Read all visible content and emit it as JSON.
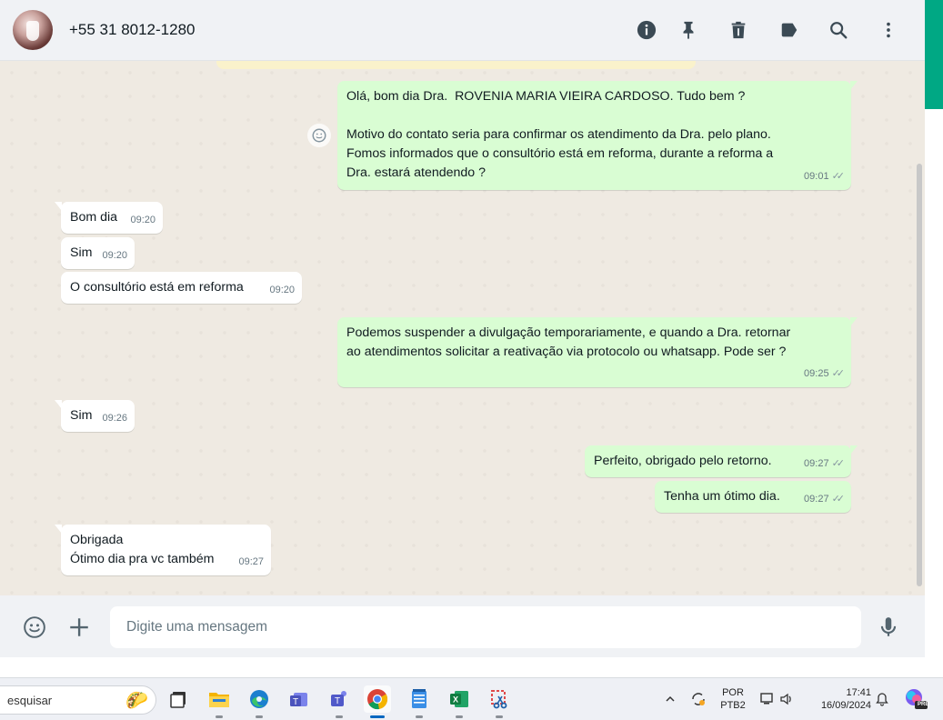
{
  "header": {
    "contact_name": "+55 31 8012-1280",
    "icons": [
      "info-icon",
      "pin-icon",
      "delete-icon",
      "label-icon",
      "search-icon",
      "menu-icon"
    ]
  },
  "messages": [
    {
      "direction": "out",
      "text": "Olá, bom dia Dra.  ROVENIA MARIA VIEIRA CARDOSO. Tudo bem ?\n\nMotivo do contato seria para confirmar os atendimento da Dra. pelo plano.\nFomos informados que o consultório está em reforma, durante a reforma a\nDra. estará atendendo ?",
      "time": "09:01",
      "ticks": "✓✓"
    },
    {
      "direction": "in",
      "text": "Bom dia",
      "time": "09:20"
    },
    {
      "direction": "in",
      "text": "Sim",
      "time": "09:20"
    },
    {
      "direction": "in",
      "text": "O consultório está em reforma",
      "time": "09:20"
    },
    {
      "direction": "out",
      "text": "Podemos suspender a divulgação temporariamente, e quando a Dra. retornar\nao atendimentos solicitar a reativação via protocolo ou whatsapp. Pode ser ?",
      "time": "09:25",
      "ticks": "✓✓"
    },
    {
      "direction": "in",
      "text": "Sim",
      "time": "09:26"
    },
    {
      "direction": "out",
      "text": "Perfeito, obrigado pelo retorno.",
      "time": "09:27",
      "ticks": "✓✓"
    },
    {
      "direction": "out",
      "text": "Tenha um ótimo dia.",
      "time": "09:27",
      "ticks": "✓✓"
    },
    {
      "direction": "in",
      "text": "Obrigada\nÓtimo dia pra vc também",
      "time": "09:27"
    }
  ],
  "composer": {
    "placeholder": "Digite uma mensagem",
    "icons": [
      "emoji-icon",
      "attach-plus-icon",
      "microphone-icon"
    ]
  },
  "taskbar": {
    "search_text": "esquisar",
    "apps": [
      "task-view",
      "file-explorer",
      "edge",
      "teams",
      "teams-classic",
      "chrome",
      "notepad",
      "excel",
      "snipping-tool"
    ],
    "language_top": "POR",
    "language_bottom": "PTB2",
    "time": "17:41",
    "date": "16/09/2024",
    "copilot_badge": "PRE"
  },
  "colors": {
    "accent": "#00a884",
    "outgoing_bubble": "#d9fdd3",
    "incoming_bubble": "#ffffff",
    "chat_bg": "#efeae2",
    "header_bg": "#f0f2f5"
  }
}
